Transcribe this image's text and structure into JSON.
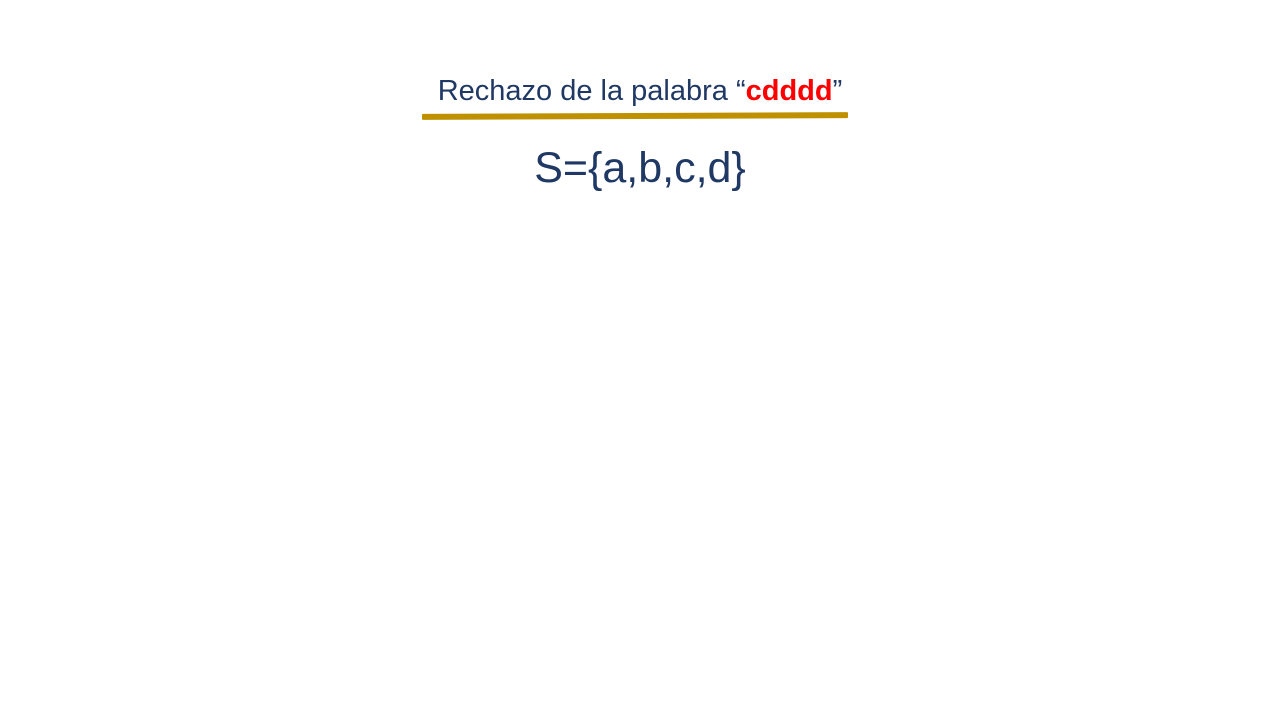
{
  "slide": {
    "title_prefix": "Rechazo de la palabra “",
    "title_word": "cdddd",
    "title_suffix": "”",
    "alphabet": "S={a,b,c,d}"
  },
  "colors": {
    "title_text": "#1f3864",
    "highlight_word": "#ff0000",
    "underline": "#bf9000",
    "background": "#ffffff"
  }
}
